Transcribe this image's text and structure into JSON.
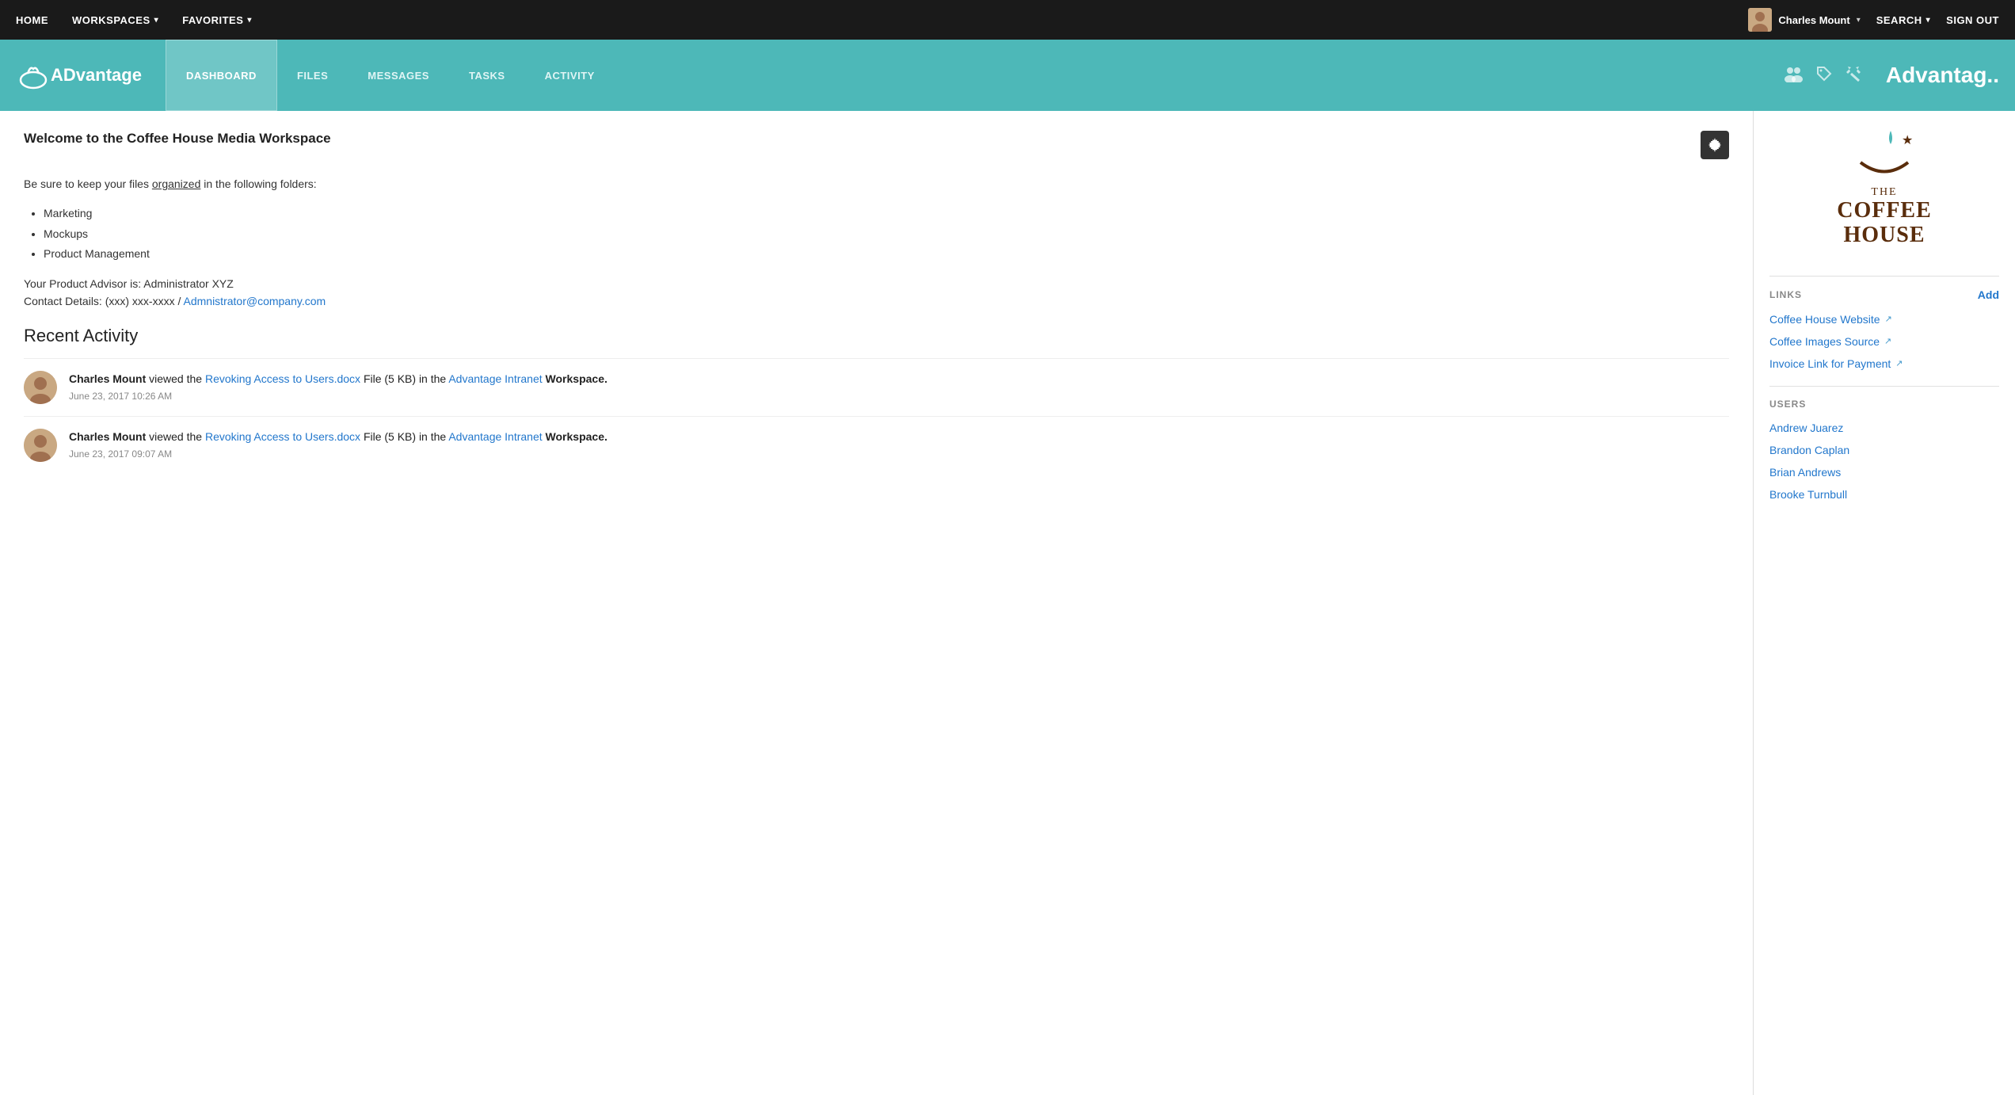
{
  "topnav": {
    "items": [
      {
        "label": "HOME",
        "hasArrow": false
      },
      {
        "label": "WORKSPACES",
        "hasArrow": true
      },
      {
        "label": "FAVORITES",
        "hasArrow": true
      }
    ],
    "user": {
      "name": "Charles Mount",
      "hasArrow": true
    },
    "search_label": "SEARCH",
    "signout_label": "SIGN OUT"
  },
  "workspace_nav": {
    "logo_text_prefix": "AD",
    "logo_text_suffix": "vantage",
    "tabs": [
      {
        "label": "DASHBOARD",
        "active": true
      },
      {
        "label": "FILES",
        "active": false
      },
      {
        "label": "MESSAGES",
        "active": false
      },
      {
        "label": "TASKS",
        "active": false
      },
      {
        "label": "ACTIVITY",
        "active": false
      }
    ],
    "workspace_title": "Advantag.."
  },
  "content": {
    "welcome_title": "Welcome to the Coffee House Media Workspace",
    "welcome_body_1": "Be sure to keep your files",
    "welcome_underline": "organized",
    "welcome_body_2": "in the following folders:",
    "folders": [
      "Marketing",
      "Mockups",
      "Product Management"
    ],
    "advisor_line": "Your Product Advisor is: Administrator XYZ",
    "contact_line": "Contact Details: (xxx) xxx-xxxx /",
    "contact_email": "Admnistrator@company.com",
    "recent_activity_title": "Recent Activity",
    "activities": [
      {
        "user": "Charles Mount",
        "action_prefix": "viewed",
        "file_link": "Revoking Access to Users.docx",
        "action_suffix": "File (5 KB) in the",
        "workspace_link": "Advantage Intranet",
        "action_end": "Workspace.",
        "timestamp": "June 23, 2017 10:26 AM"
      },
      {
        "user": "Charles Mount",
        "action_prefix": "viewed",
        "file_link": "Revoking Access to Users.docx",
        "action_suffix": "File (5 KB) in the",
        "workspace_link": "Advantage Intranet",
        "action_end": "Workspace.",
        "timestamp": "June 23, 2017 09:07 AM"
      }
    ]
  },
  "sidebar": {
    "links_section_title": "LINKS",
    "add_label": "Add",
    "links": [
      {
        "label": "Coffee House Website"
      },
      {
        "label": "Coffee Images Source"
      },
      {
        "label": "Invoice Link for Payment"
      }
    ],
    "users_section_title": "USERS",
    "users": [
      {
        "label": "Andrew Juarez"
      },
      {
        "label": "Brandon Caplan"
      },
      {
        "label": "Brian Andrews"
      },
      {
        "label": "Brooke Turnbull"
      }
    ]
  }
}
